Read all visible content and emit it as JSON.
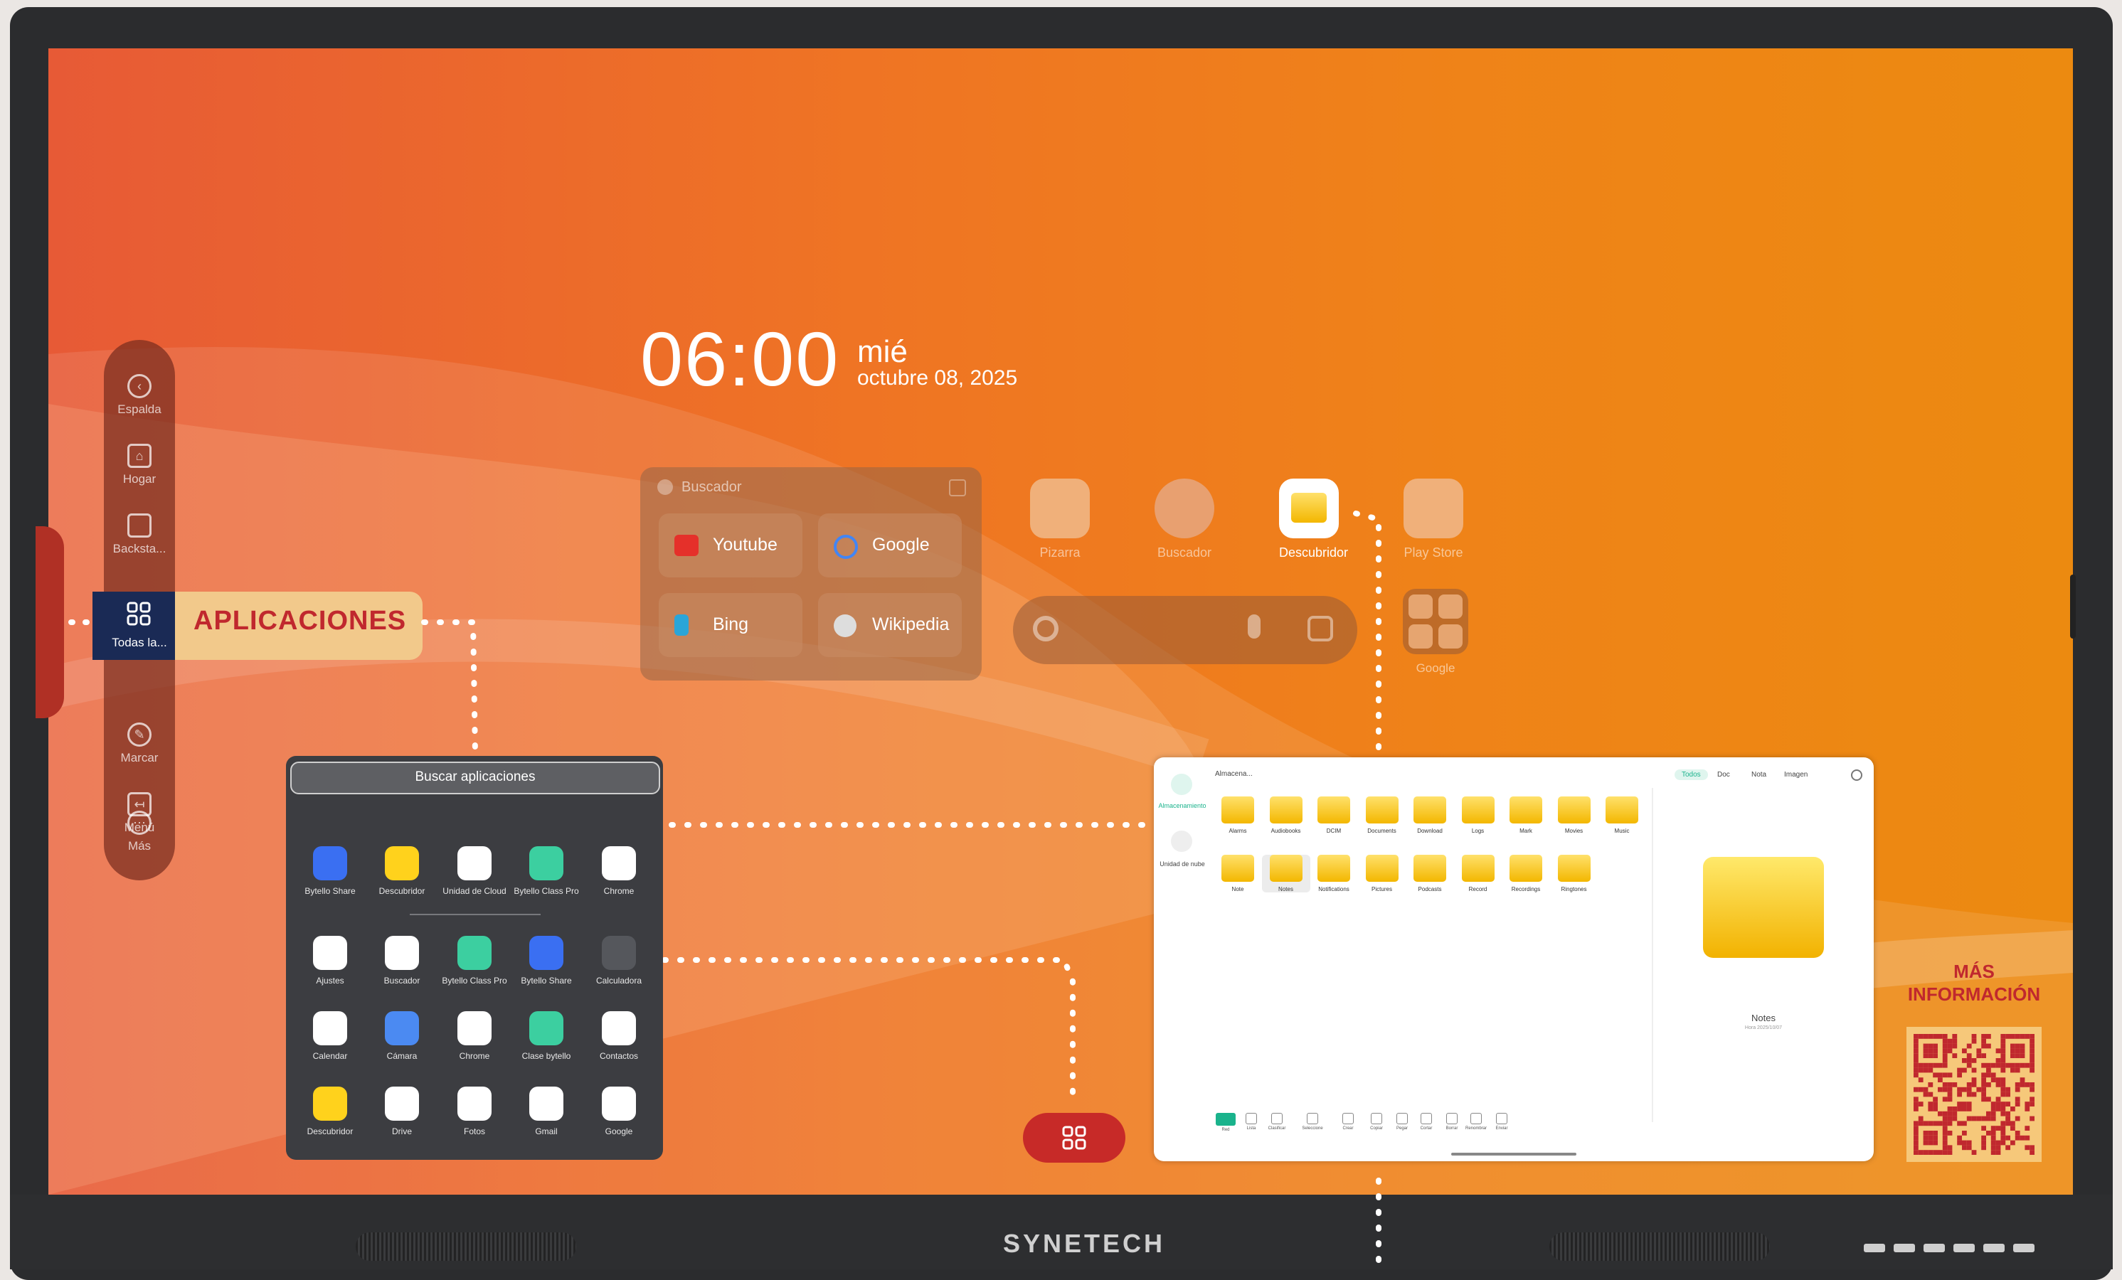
{
  "brand": "SYNETECH",
  "sidebar": {
    "items": [
      {
        "label": "Espalda",
        "icon": "back-icon"
      },
      {
        "label": "Hogar",
        "icon": "home-icon"
      },
      {
        "label": "Backsta...",
        "icon": "backstage-icon"
      },
      {
        "label": "Todas la...",
        "icon": "apps-grid-icon"
      },
      {
        "label": "Marcar",
        "icon": "annotate-icon"
      },
      {
        "label": "Menú",
        "icon": "menu-icon"
      },
      {
        "label": "Más",
        "icon": "more-icon"
      }
    ]
  },
  "callout": {
    "apps": "APLICACIONES",
    "more_info_line1": "MÁS",
    "more_info_line2": "INFORMACIÓN"
  },
  "clock": {
    "time": "06:00",
    "day": "mié",
    "date": "octubre 08, 2025"
  },
  "search_widget": {
    "title": "Buscador",
    "engines": [
      {
        "label": "Youtube",
        "color": "#e5302a"
      },
      {
        "label": "Google",
        "color": "#4285f4"
      },
      {
        "label": "Bing",
        "color": "#2aa5d8"
      },
      {
        "label": "Wikipedia",
        "color": "#cccccc"
      }
    ]
  },
  "dock": [
    {
      "label": "Pizarra",
      "color": "#f0b07a"
    },
    {
      "label": "Buscador",
      "color": "#e8a070"
    },
    {
      "label": "Descubridor",
      "color": "#ffd21c"
    },
    {
      "label": "Play Store",
      "color": "#f0b07a"
    }
  ],
  "google_folder": {
    "label": "Google"
  },
  "drawer": {
    "search_placeholder": "Buscar aplicaciones",
    "apps": [
      {
        "label": "Bytello Share",
        "color": "#3a6ff2"
      },
      {
        "label": "Descubridor",
        "color": "#ffd21c"
      },
      {
        "label": "Unidad de Cloud",
        "color": "#ffffff"
      },
      {
        "label": "Bytello Class Pro",
        "color": "#3ccfa0"
      },
      {
        "label": "Chrome",
        "color": "#ffffff"
      },
      {
        "label": "Ajustes",
        "color": "#ffffff"
      },
      {
        "label": "Buscador",
        "color": "#ffffff"
      },
      {
        "label": "Bytello Class Pro",
        "color": "#3ccfa0"
      },
      {
        "label": "Bytello Share",
        "color": "#3a6ff2"
      },
      {
        "label": "Calculadora",
        "color": "#55575c"
      },
      {
        "label": "Calendar",
        "color": "#ffffff"
      },
      {
        "label": "Cámara",
        "color": "#4b8af2"
      },
      {
        "label": "Chrome",
        "color": "#ffffff"
      },
      {
        "label": "Clase bytello",
        "color": "#3ccfa0"
      },
      {
        "label": "Contactos",
        "color": "#ffffff"
      },
      {
        "label": "Descubridor",
        "color": "#ffd21c"
      },
      {
        "label": "Drive",
        "color": "#ffffff"
      },
      {
        "label": "Fotos",
        "color": "#ffffff"
      },
      {
        "label": "Gmail",
        "color": "#ffffff"
      },
      {
        "label": "Google",
        "color": "#ffffff"
      }
    ]
  },
  "file_manager": {
    "breadcrumb": "Almacena...",
    "side": [
      "Almacenamiento",
      "Unidad de nube"
    ],
    "filters": [
      "Todos",
      "Doc",
      "Nota",
      "Imagen"
    ],
    "folders": [
      "Alarms",
      "Audiobooks",
      "DCIM",
      "Documents",
      "Download",
      "Logs",
      "Mark",
      "Movies",
      "Music",
      "Note",
      "Notes",
      "Notifications",
      "Pictures",
      "Podcasts",
      "Record",
      "Recordings",
      "Ringtones"
    ],
    "selected": {
      "name": "Notes",
      "meta": "Hora 2025/10/07"
    },
    "toolbar": [
      "Red",
      "Lista",
      "Clasificar",
      "Seleccione",
      "Crear",
      "Copiar",
      "Pegar",
      "Cortar",
      "Borrar",
      "Renombrar",
      "Enviar"
    ]
  }
}
